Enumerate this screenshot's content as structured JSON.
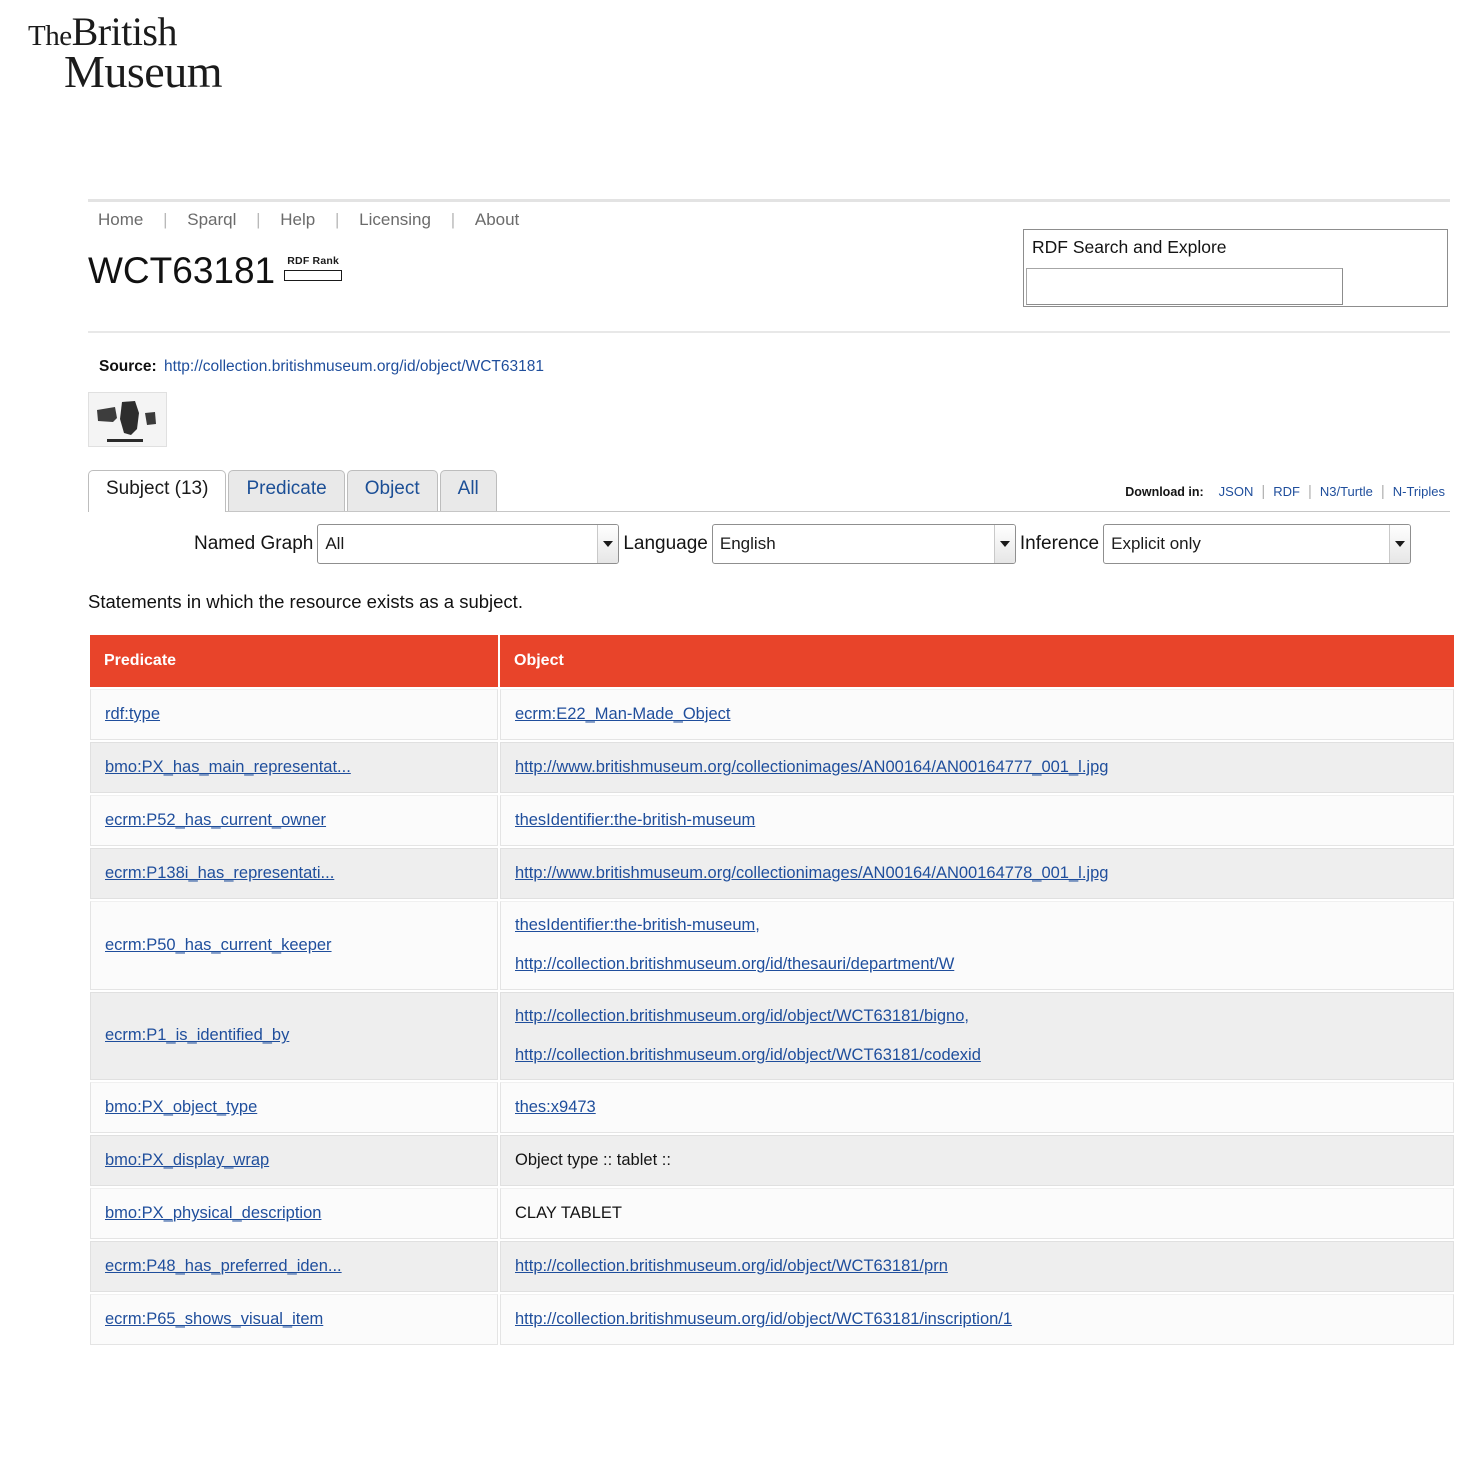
{
  "logo": {
    "the": "The",
    "british": "British",
    "museum": "Museum"
  },
  "nav": {
    "items": [
      {
        "label": "Home"
      },
      {
        "label": "Sparql"
      },
      {
        "label": "Help"
      },
      {
        "label": "Licensing"
      },
      {
        "label": "About"
      }
    ],
    "separator": "|"
  },
  "header": {
    "title": "WCT63181",
    "rdf_rank_label": "RDF Rank",
    "rdf_rank_value": 0
  },
  "search": {
    "title": "RDF Search and Explore",
    "value": "",
    "placeholder": ""
  },
  "source": {
    "label": "Source:",
    "url": "http://collection.britishmuseum.org/id/object/WCT63181"
  },
  "thumbnail": {
    "alt": "clay tablet fragments photograph"
  },
  "tabs": [
    {
      "label": "Subject (13)",
      "active": true
    },
    {
      "label": "Predicate",
      "active": false
    },
    {
      "label": "Object",
      "active": false
    },
    {
      "label": "All",
      "active": false
    }
  ],
  "download": {
    "label": "Download in:",
    "formats": [
      "JSON",
      "RDF",
      "N3/Turtle",
      "N-Triples"
    ],
    "separator": "|"
  },
  "filters": {
    "named_graph": {
      "label": "Named Graph",
      "value": "All"
    },
    "language": {
      "label": "Language",
      "value": "English"
    },
    "inference": {
      "label": "Inference",
      "value": "Explicit only"
    }
  },
  "statements_caption": "Statements in which the resource exists as a subject.",
  "table": {
    "columns": [
      "Predicate",
      "Object"
    ],
    "rows": [
      {
        "predicate": "rdf:type",
        "objects": [
          {
            "text": "ecrm:E22_Man-Made_Object",
            "link": true
          }
        ]
      },
      {
        "predicate": "bmo:PX_has_main_representat...",
        "objects": [
          {
            "text": "http://www.britishmuseum.org/collectionimages/AN00164/AN00164777_001_l.jpg",
            "link": true
          }
        ]
      },
      {
        "predicate": "ecrm:P52_has_current_owner",
        "objects": [
          {
            "text": "thesIdentifier:the-british-museum",
            "link": true
          }
        ]
      },
      {
        "predicate": "ecrm:P138i_has_representati...",
        "objects": [
          {
            "text": "http://www.britishmuseum.org/collectionimages/AN00164/AN00164778_001_l.jpg",
            "link": true
          }
        ]
      },
      {
        "predicate": "ecrm:P50_has_current_keeper",
        "objects": [
          {
            "text": "thesIdentifier:the-british-museum",
            "link": true,
            "separator": ","
          },
          {
            "text": "http://collection.britishmuseum.org/id/thesauri/department/W",
            "link": true
          }
        ]
      },
      {
        "predicate": "ecrm:P1_is_identified_by",
        "objects": [
          {
            "text": "http://collection.britishmuseum.org/id/object/WCT63181/bigno",
            "link": true,
            "separator": ","
          },
          {
            "text": "http://collection.britishmuseum.org/id/object/WCT63181/codexid",
            "link": true
          }
        ]
      },
      {
        "predicate": "bmo:PX_object_type",
        "objects": [
          {
            "text": "thes:x9473",
            "link": true
          }
        ]
      },
      {
        "predicate": "bmo:PX_display_wrap",
        "objects": [
          {
            "text": "Object type :: tablet ::",
            "link": false
          }
        ]
      },
      {
        "predicate": "bmo:PX_physical_description",
        "objects": [
          {
            "text": "CLAY TABLET",
            "link": false
          }
        ]
      },
      {
        "predicate": "ecrm:P48_has_preferred_iden...",
        "objects": [
          {
            "text": "http://collection.britishmuseum.org/id/object/WCT63181/prn",
            "link": true
          }
        ]
      },
      {
        "predicate": "ecrm:P65_shows_visual_item",
        "objects": [
          {
            "text": "http://collection.britishmuseum.org/id/object/WCT63181/inscription/1",
            "link": true
          }
        ]
      }
    ]
  },
  "colors": {
    "table_header": "#e8442a",
    "link": "#1f4e9c",
    "nav_text": "#6b6b6b"
  }
}
